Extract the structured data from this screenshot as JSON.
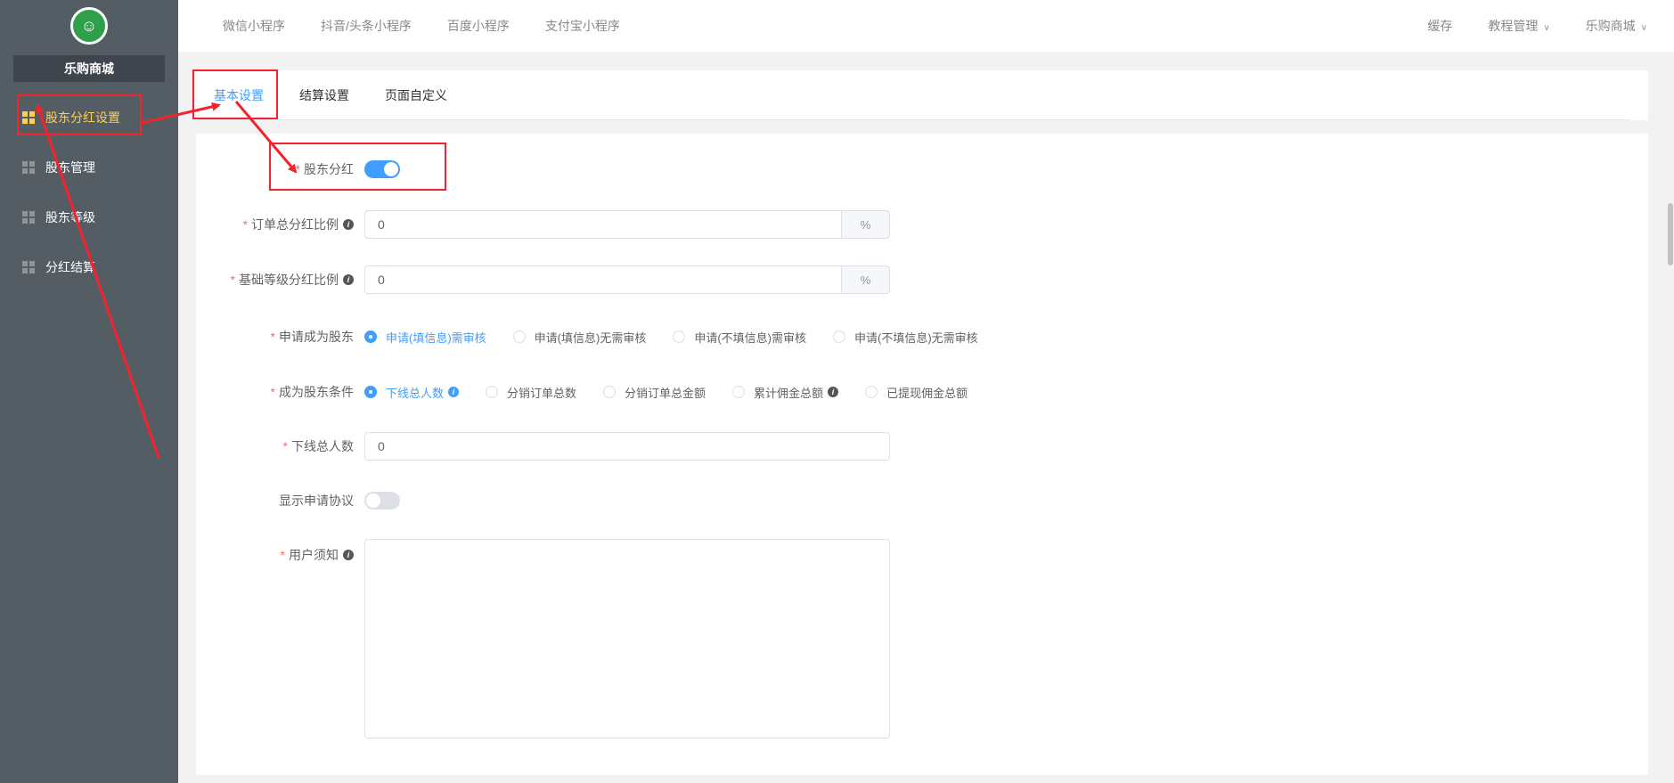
{
  "sidebar": {
    "shop_name": "乐购商城",
    "items": [
      {
        "label": "股东分红设置",
        "active": true
      },
      {
        "label": "股东管理",
        "active": false
      },
      {
        "label": "股东等级",
        "active": false
      },
      {
        "label": "分红结算",
        "active": false
      }
    ]
  },
  "topnav": {
    "items": [
      "微信小程序",
      "抖音/头条小程序",
      "百度小程序",
      "支付宝小程序"
    ],
    "right": [
      "缓存",
      "教程管理",
      "乐购商城"
    ]
  },
  "tabs": [
    "基本设置",
    "结算设置",
    "页面自定义"
  ],
  "form": {
    "dividend": {
      "label": "股东分红",
      "on": true
    },
    "order_ratio": {
      "label": "订单总分红比例",
      "value": "0",
      "unit": "%"
    },
    "base_ratio": {
      "label": "基础等级分红比例",
      "value": "0",
      "unit": "%"
    },
    "apply": {
      "label": "申请成为股东",
      "options": [
        "申请(填信息)需审核",
        "申请(填信息)无需审核",
        "申请(不填信息)需审核",
        "申请(不填信息)无需审核"
      ],
      "selected": 0
    },
    "condition": {
      "label": "成为股东条件",
      "options": [
        "下线总人数",
        "分销订单总数",
        "分销订单总金额",
        "累计佣金总额",
        "已提现佣金总额"
      ],
      "selected": 0
    },
    "downline": {
      "label": "下线总人数",
      "value": "0"
    },
    "show_agreement": {
      "label": "显示申请协议",
      "on": false
    },
    "notice": {
      "label": "用户须知",
      "value": ""
    }
  },
  "colors": {
    "accent": "#409eff",
    "sidebar": "#545c64",
    "active_menu": "#ffd04b",
    "annotation": "#f5222d"
  }
}
